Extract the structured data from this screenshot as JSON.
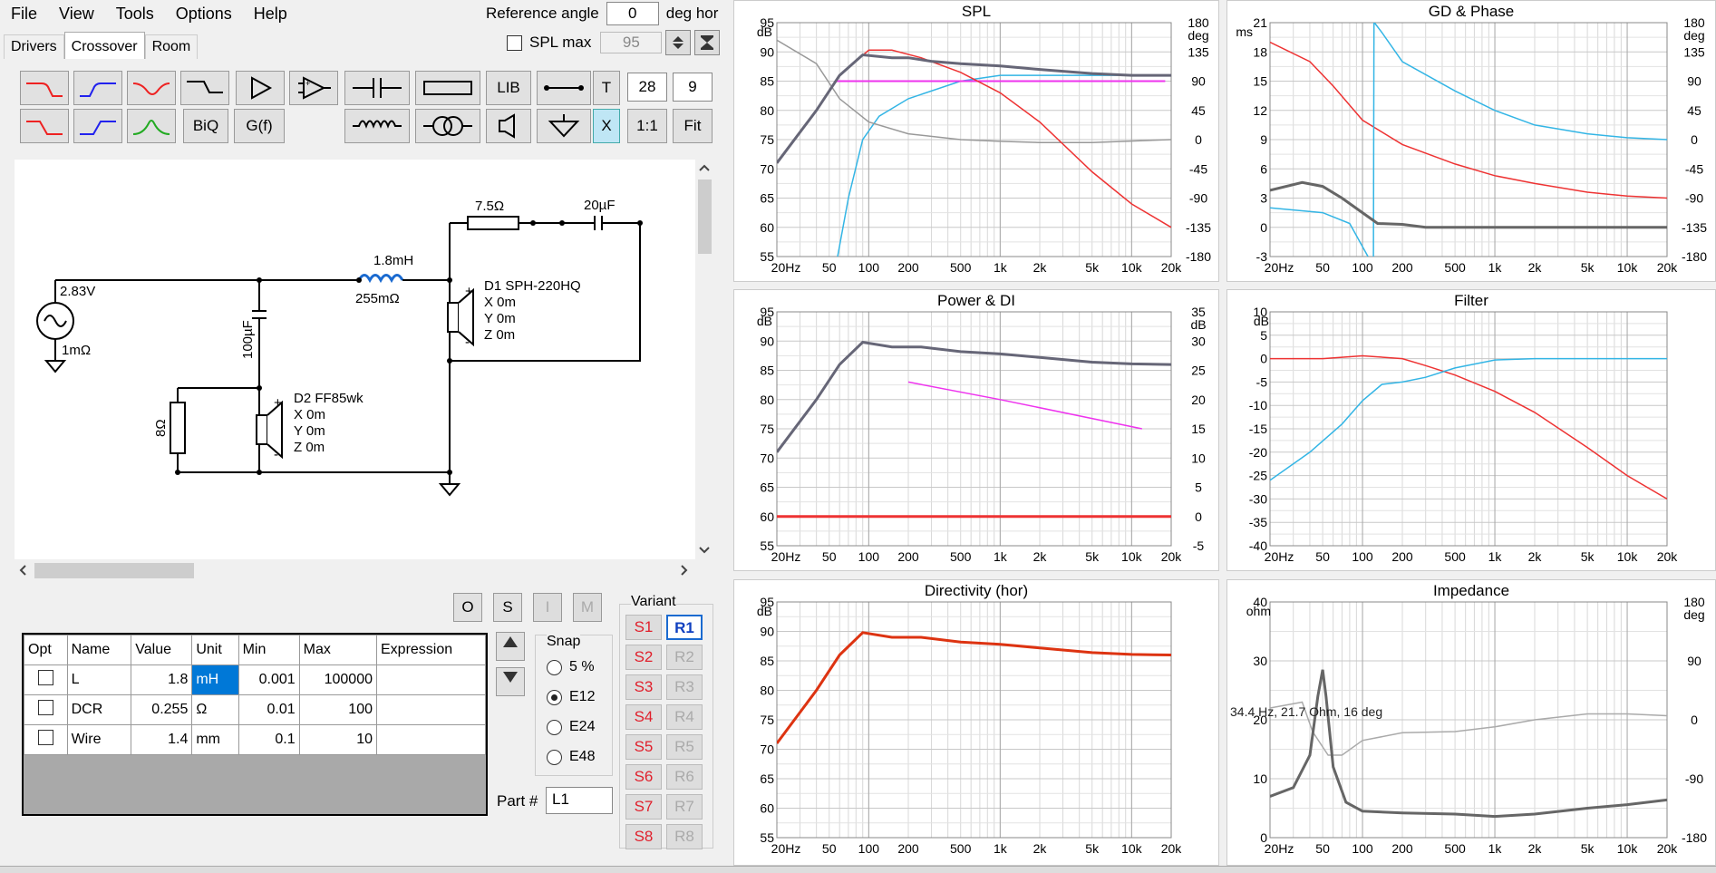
{
  "menu": [
    "File",
    "View",
    "Tools",
    "Options",
    "Help"
  ],
  "reference": {
    "label": "Reference angle",
    "value": "0",
    "unit": "deg hor"
  },
  "spl_max": {
    "label": "SPL max",
    "value": "95"
  },
  "tabs": [
    "Drivers",
    "Crossover",
    "Room"
  ],
  "toolbar": {
    "lib": "LIB",
    "t": "T",
    "t_val": "28",
    "t_val2": "9",
    "biq": "BiQ",
    "gf": "G(f)",
    "x": "X",
    "one_to_one": "1:1",
    "fit": "Fit"
  },
  "schematic": {
    "source_v": "2.83V",
    "source_r": "1mΩ",
    "resistor1": "7.5Ω",
    "cap1": "20µF",
    "inductor": "1.8mH",
    "inductor_dcr": "255mΩ",
    "cap2": "100µF",
    "resistor2": "8Ω",
    "d1": {
      "name": "D1 SPH-220HQ",
      "x": "X 0m",
      "y": "Y 0m",
      "z": "Z 0m"
    },
    "d2": {
      "name": "D2 FF85wk",
      "x": "X 0m",
      "y": "Y 0m",
      "z": "Z 0m"
    }
  },
  "osim": [
    "O",
    "S",
    "I",
    "M"
  ],
  "params_table": {
    "headers": [
      "Opt",
      "Name",
      "Value",
      "Unit",
      "Min",
      "Max",
      "Expression"
    ],
    "rows": [
      {
        "name": "L",
        "value": "1.8",
        "unit": "mH",
        "min": "0.001",
        "max": "100000"
      },
      {
        "name": "DCR",
        "value": "0.255",
        "unit": "Ω",
        "min": "0.01",
        "max": "100"
      },
      {
        "name": "Wire",
        "value": "1.4",
        "unit": "mm",
        "min": "0.1",
        "max": "10"
      }
    ]
  },
  "snap": {
    "label": "Snap",
    "options": [
      "5 %",
      "E12",
      "E24",
      "E48"
    ],
    "selected": "E12"
  },
  "variant": {
    "label": "Variant",
    "s": [
      "S1",
      "S2",
      "S3",
      "S4",
      "S5",
      "S6",
      "S7",
      "S8"
    ],
    "r": [
      "R1",
      "R2",
      "R3",
      "R4",
      "R5",
      "R6",
      "R7",
      "R8"
    ],
    "active": "R1"
  },
  "part": {
    "label": "Part #",
    "value": "L1"
  },
  "freq_ticks": [
    "20Hz",
    "50",
    "100",
    "200",
    "500",
    "1k",
    "2k",
    "5k",
    "10k",
    "20k"
  ],
  "panels": {
    "spl": {
      "title": "SPL",
      "left_unit": "dB",
      "right_unit": "deg",
      "left_ticks": [
        "95",
        "90",
        "85",
        "80",
        "75",
        "70",
        "65",
        "60",
        "55"
      ],
      "right_ticks": [
        "180",
        "135",
        "90",
        "45",
        "0",
        "-45",
        "-90",
        "-135",
        "-180"
      ]
    },
    "gd": {
      "title": "GD & Phase",
      "left_unit": "ms",
      "right_unit": "deg",
      "left_ticks": [
        "21",
        "18",
        "15",
        "12",
        "9",
        "6",
        "3",
        "0",
        "-3"
      ],
      "right_ticks": [
        "180",
        "135",
        "90",
        "45",
        "0",
        "-45",
        "-90",
        "-135",
        "-180"
      ]
    },
    "power": {
      "title": "Power & DI",
      "left_unit": "dB",
      "right_unit": "dB",
      "left_ticks": [
        "95",
        "90",
        "85",
        "80",
        "75",
        "70",
        "65",
        "60",
        "55"
      ],
      "right_ticks": [
        "35",
        "30",
        "25",
        "20",
        "15",
        "10",
        "5",
        "0",
        "-5"
      ]
    },
    "filter": {
      "title": "Filter",
      "left_unit": "dB",
      "left_ticks": [
        "10",
        "5",
        "0",
        "-5",
        "-10",
        "-15",
        "-20",
        "-25",
        "-30",
        "-35",
        "-40"
      ]
    },
    "directivity": {
      "title": "Directivity (hor)",
      "left_unit": "dB",
      "left_ticks": [
        "95",
        "90",
        "85",
        "80",
        "75",
        "70",
        "65",
        "60",
        "55"
      ]
    },
    "impedance": {
      "title": "Impedance",
      "left_unit": "ohm",
      "right_unit": "deg",
      "left_ticks": [
        "40",
        "30",
        "20",
        "10",
        "0"
      ],
      "right_ticks": [
        "180",
        "90",
        "0",
        "-90",
        "-180"
      ],
      "readout": "34.4 Hz, 21.7 Ohm, 16 deg"
    }
  },
  "colors": {
    "red": "#ee3333",
    "blue": "#33b5e5",
    "gray": "#666666",
    "magenta": "#ee33ee",
    "accent": "#0078d7"
  }
}
